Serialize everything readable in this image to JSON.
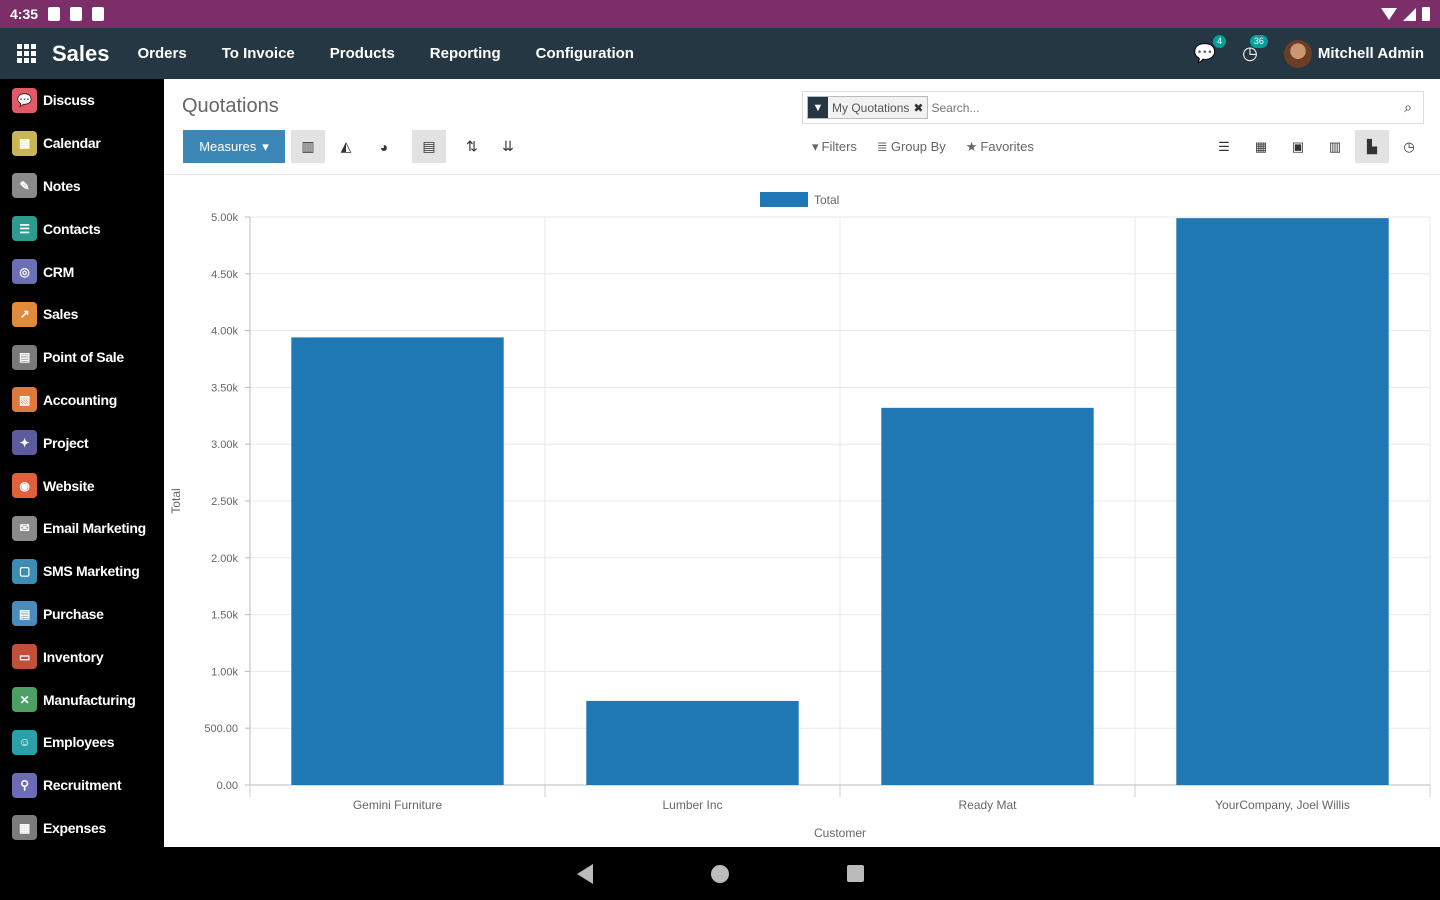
{
  "status_bar": {
    "time": "4:35"
  },
  "topnav": {
    "app_name": "Sales",
    "menu": [
      "Orders",
      "To Invoice",
      "Products",
      "Reporting",
      "Configuration"
    ],
    "messages_badge": "4",
    "activities_badge": "36",
    "user_name": "Mitchell Admin"
  },
  "sidebar": {
    "items": [
      {
        "label": "Discuss",
        "color": "#e05a67",
        "icon": "discuss-icon",
        "glyph": "💬"
      },
      {
        "label": "Calendar",
        "color": "#c9b458",
        "icon": "calendar-icon",
        "glyph": "▦"
      },
      {
        "label": "Notes",
        "color": "#8a8a8a",
        "icon": "notes-icon",
        "glyph": "✎"
      },
      {
        "label": "Contacts",
        "color": "#2d9c8f",
        "icon": "contacts-icon",
        "glyph": "☰"
      },
      {
        "label": "CRM",
        "color": "#6b6fb5",
        "icon": "crm-icon",
        "glyph": "◎"
      },
      {
        "label": "Sales",
        "color": "#e08a3c",
        "icon": "sales-icon",
        "glyph": "↗"
      },
      {
        "label": "Point of Sale",
        "color": "#7a7a7a",
        "icon": "point-of-sale-icon",
        "glyph": "▤"
      },
      {
        "label": "Accounting",
        "color": "#e0773c",
        "icon": "accounting-icon",
        "glyph": "▧"
      },
      {
        "label": "Project",
        "color": "#5c5c9c",
        "icon": "project-icon",
        "glyph": "✦"
      },
      {
        "label": "Website",
        "color": "#e0603c",
        "icon": "website-icon",
        "glyph": "◉"
      },
      {
        "label": "Email Marketing",
        "color": "#8a8a8a",
        "icon": "email-marketing-icon",
        "glyph": "✉"
      },
      {
        "label": "SMS Marketing",
        "color": "#3c8cb4",
        "icon": "sms-marketing-icon",
        "glyph": "▢"
      },
      {
        "label": "Purchase",
        "color": "#4c8cbc",
        "icon": "purchase-icon",
        "glyph": "▤"
      },
      {
        "label": "Inventory",
        "color": "#c0503c",
        "icon": "inventory-icon",
        "glyph": "▭"
      },
      {
        "label": "Manufacturing",
        "color": "#4ca064",
        "icon": "manufacturing-icon",
        "glyph": "✕"
      },
      {
        "label": "Employees",
        "color": "#2ca0a8",
        "icon": "employees-icon",
        "glyph": "☺"
      },
      {
        "label": "Recruitment",
        "color": "#6c6cb4",
        "icon": "recruitment-icon",
        "glyph": "⚲"
      },
      {
        "label": "Expenses",
        "color": "#7c7c7c",
        "icon": "expenses-icon",
        "glyph": "▦"
      }
    ]
  },
  "control_panel": {
    "title": "Quotations",
    "measures_label": "Measures",
    "search_facet": "My Quotations",
    "search_placeholder": "Search...",
    "filters_label": "Filters",
    "group_by_label": "Group By",
    "favorites_label": "Favorites"
  },
  "chart_data": {
    "type": "bar",
    "categories": [
      "Gemini Furniture",
      "Lumber Inc",
      "Ready Mat",
      "YourCompany, Joel Willis"
    ],
    "series": [
      {
        "name": "Total",
        "values": [
          3940,
          740,
          3320,
          4990
        ],
        "color": "#1f77b4"
      }
    ],
    "xlabel": "Customer",
    "ylabel": "Total",
    "ylim": [
      0,
      5000
    ],
    "yticks": [
      "0.00",
      "500.00",
      "1.00k",
      "1.50k",
      "2.00k",
      "2.50k",
      "3.00k",
      "3.50k",
      "4.00k",
      "4.50k",
      "5.00k"
    ],
    "legend": "top-center",
    "grid": true
  }
}
